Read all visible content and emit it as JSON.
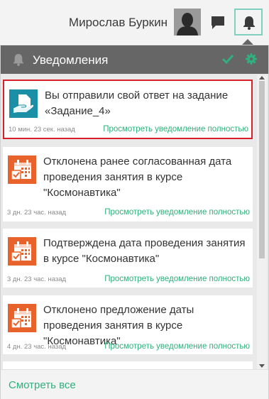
{
  "header": {
    "user_name": "Мирослав Буркин",
    "avatar_icon": "user-silhouette-icon",
    "messages_icon": "chat-bubble-icon",
    "notifications_icon": "bell-icon"
  },
  "panel": {
    "title": "Уведомления",
    "title_icon": "bell-icon",
    "mark_read_icon": "check-icon",
    "settings_icon": "gear-icon",
    "footer_link": "Смотреть все"
  },
  "notifications": [
    {
      "text": "Вы отправили свой ответ на задание «Задание_4»",
      "time": "10 мин. 23 сек. назад",
      "link": "Просмотреть уведомление полностью",
      "icon": "assignment-submitted-icon",
      "highlighted": true
    },
    {
      "text": "Отклонена ранее согласованная дата проведения занятия в курсе \"Космонавтика\"",
      "time": "3 дн. 23 час. назад",
      "link": "Просмотреть уведомление полностью",
      "icon": "calendar-check-icon"
    },
    {
      "text": "Подтверждена дата проведения занятия в курсе \"Космонавтика\"",
      "time": "3 дн. 23 час. назад",
      "link": "Просмотреть уведомление полностью",
      "icon": "calendar-check-icon"
    },
    {
      "text": "Отклонено предложение даты проведения занятия в курсе \"Космонавтика\"",
      "time": "4 дн. 23 час. назад",
      "link": "Просмотреть уведомление полностью",
      "icon": "calendar-check-icon"
    }
  ],
  "colors": {
    "accent": "#2fb07c",
    "header_bg": "#666666",
    "highlight_border": "#d9202a",
    "bell_border": "#7fd0be",
    "calendar_icon": "#e8622c",
    "assignment_icon": "#1b8fa6"
  }
}
